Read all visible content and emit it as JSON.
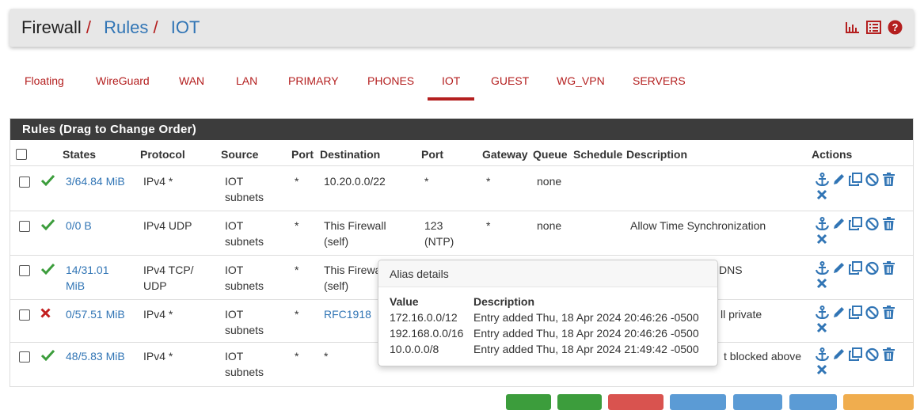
{
  "breadcrumb": {
    "part1": "Firewall",
    "sep1": "/",
    "part2": "Rules",
    "sep2": "/",
    "part3": "IOT"
  },
  "header_icons": [
    "bar-chart-icon",
    "list-icon",
    "help-icon"
  ],
  "tabs": [
    {
      "label": "Floating"
    },
    {
      "label": "WireGuard"
    },
    {
      "label": "WAN"
    },
    {
      "label": "LAN"
    },
    {
      "label": "PRIMARY"
    },
    {
      "label": "PHONES"
    },
    {
      "label": "IOT",
      "active": true
    },
    {
      "label": "GUEST"
    },
    {
      "label": "WG_VPN"
    },
    {
      "label": "SERVERS"
    }
  ],
  "panel": {
    "title": "Rules (Drag to Change Order)"
  },
  "columns": {
    "states": "States",
    "protocol": "Protocol",
    "source": "Source",
    "port": "Port",
    "destination": "Destination",
    "port2": "Port",
    "gateway": "Gateway",
    "queue": "Queue",
    "schedule": "Schedule",
    "description": "Description",
    "actions": "Actions"
  },
  "rows": [
    {
      "status": "pass",
      "states_l1": "3/64.84 MiB",
      "states_l2": "",
      "proto_l1": "IPv4 *",
      "proto_l2": "",
      "source_l1": "IOT",
      "source_l2": "subnets",
      "port": "*",
      "dest_l1": "10.20.0.0/22",
      "dest_l2": "",
      "dport_l1": "*",
      "dport_l2": "",
      "gateway": "*",
      "queue": "none",
      "schedule": "",
      "description": ""
    },
    {
      "status": "pass",
      "states_l1": "0/0 B",
      "states_l2": "",
      "proto_l1": "IPv4 UDP",
      "proto_l2": "",
      "source_l1": "IOT",
      "source_l2": "subnets",
      "port": "*",
      "dest_l1": "This Firewall",
      "dest_l2": "(self)",
      "dport_l1": "123",
      "dport_l2": "(NTP)",
      "gateway": "*",
      "queue": "none",
      "schedule": "",
      "description": "Allow Time Synchronization"
    },
    {
      "status": "pass",
      "states_l1": "14/31.01",
      "states_l2": "MiB",
      "proto_l1": "IPv4 TCP/",
      "proto_l2": "UDP",
      "source_l1": "IOT",
      "source_l2": "subnets",
      "port": "*",
      "dest_l1": "This Firewa",
      "dest_l2": "(self)",
      "dport_l1": "",
      "dport_l2": "",
      "gateway": "",
      "queue": "",
      "schedule": "",
      "description": "DNS"
    },
    {
      "status": "block",
      "states_l1": "0/57.51 MiB",
      "states_l2": "",
      "proto_l1": "IPv4 *",
      "proto_l2": "",
      "source_l1": "IOT",
      "source_l2": "subnets",
      "port": "*",
      "dest_l1": "RFC1918",
      "dest_l2": "",
      "dport_l1": "",
      "dport_l2": "",
      "gateway": "",
      "queue": "",
      "schedule": "",
      "description": "ll private"
    },
    {
      "status": "pass",
      "states_l1": "48/5.83 MiB",
      "states_l2": "",
      "proto_l1": "IPv4 *",
      "proto_l2": "",
      "source_l1": "IOT",
      "source_l2": "subnets",
      "port": "*",
      "dest_l1": "*",
      "dest_l2": "",
      "dport_l1": "",
      "dport_l2": "",
      "gateway": "",
      "queue": "",
      "schedule": "",
      "description": "t blocked above"
    }
  ],
  "tooltip": {
    "title": "Alias details",
    "col_value": "Value",
    "col_description": "Description",
    "entries": [
      {
        "value": "172.16.0.0/12",
        "description": "Entry added Thu, 18 Apr 2024 20:46:26 -0500"
      },
      {
        "value": "192.168.0.0/16",
        "description": "Entry added Thu, 18 Apr 2024 20:46:26 -0500"
      },
      {
        "value": "10.0.0.0/8",
        "description": "Entry added Thu, 18 Apr 2024 21:49:42 -0500"
      }
    ]
  },
  "colors": {
    "accent_red": "#b41f1f",
    "link_blue": "#3175b5",
    "pass_green": "#3c9d3c",
    "block_red": "#c21f1f",
    "panel_dark": "#3c3c3c"
  }
}
